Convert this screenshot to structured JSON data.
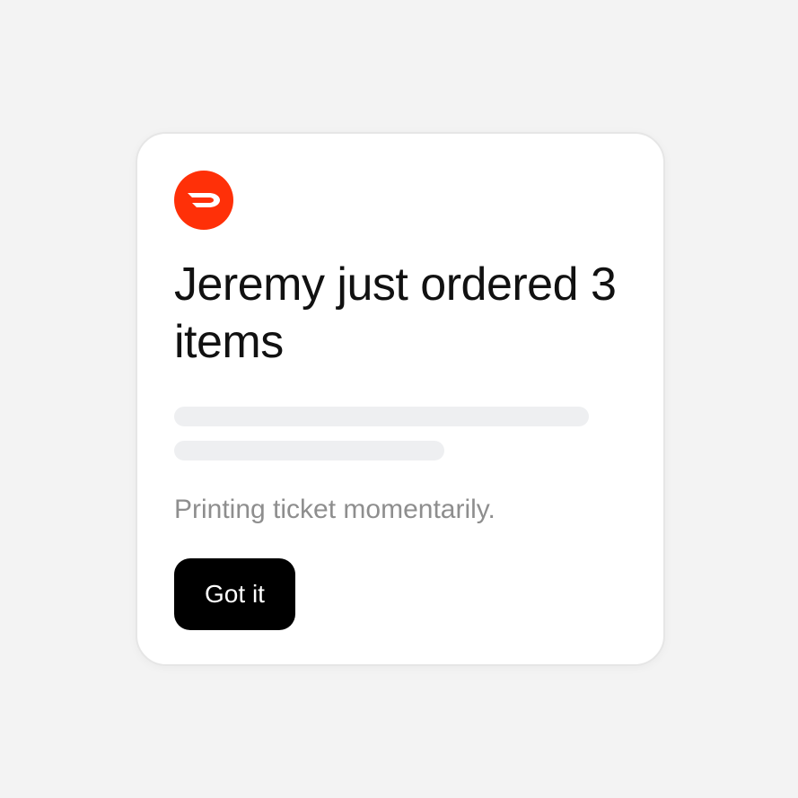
{
  "notification": {
    "logo_icon": "doordash-logo-icon",
    "brand_color": "#ff3008",
    "headline": "Jeremy just ordered 3 items",
    "status_text": "Printing ticket momentarily.",
    "button_label": "Got it"
  }
}
